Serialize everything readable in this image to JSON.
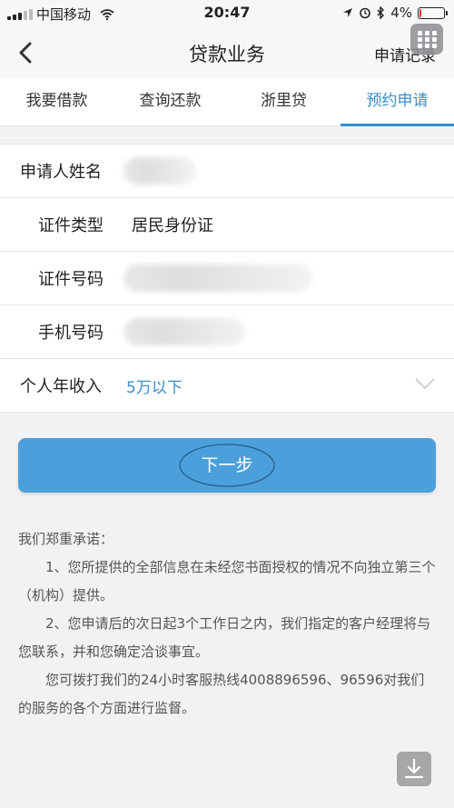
{
  "status": {
    "carrier": "中国移动",
    "time": "20:47",
    "battery": "4%",
    "battery_level": 0.04
  },
  "nav": {
    "title": "贷款业务",
    "right_link": "申请记录"
  },
  "tabs": [
    "我要借款",
    "查询还款",
    "浙里贷",
    "预约申请"
  ],
  "active_tab": 3,
  "form": {
    "name_label": "申请人姓名",
    "id_type_label": "证件类型",
    "id_type_value": "居民身份证",
    "id_number_label": "证件号码",
    "phone_label": "手机号码",
    "income_label": "个人年收入",
    "income_value": "5万以下"
  },
  "button": {
    "next": "下一步"
  },
  "notice": {
    "title": "我们郑重承诺：",
    "p1": "1、您所提供的全部信息在未经您书面授权的情况不向独立第三个（机构）提供。",
    "p2": "2、您申请后的次日起3个工作日之内，我们指定的客户经理将与您联系，并和您确定洽谈事宜。",
    "p3": "您可拨打我们的24小时客服热线4008896596、96596对我们的服务的各个方面进行监督。"
  },
  "colors": {
    "accent": "#3a8fcc",
    "button": "#4ba0dc"
  }
}
